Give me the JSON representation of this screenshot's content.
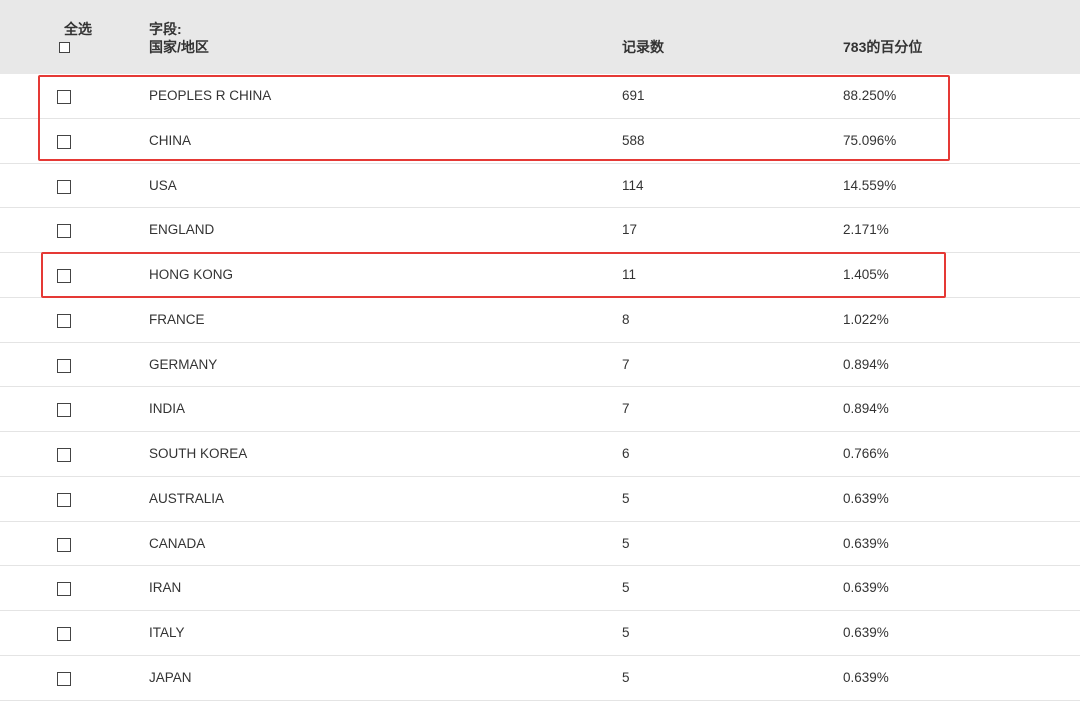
{
  "header": {
    "select_all": "全选",
    "field_label": "字段:",
    "field_name": "国家/地区",
    "count": "记录数",
    "percent": "783的百分位"
  },
  "rows": [
    {
      "name": "PEOPLES R CHINA",
      "count": "691",
      "percent": "88.250%"
    },
    {
      "name": "CHINA",
      "count": "588",
      "percent": "75.096%"
    },
    {
      "name": "USA",
      "count": "114",
      "percent": "14.559%"
    },
    {
      "name": "ENGLAND",
      "count": "17",
      "percent": "2.171%"
    },
    {
      "name": "HONG KONG",
      "count": "11",
      "percent": "1.405%"
    },
    {
      "name": "FRANCE",
      "count": "8",
      "percent": "1.022%"
    },
    {
      "name": "GERMANY",
      "count": "7",
      "percent": "0.894%"
    },
    {
      "name": "INDIA",
      "count": "7",
      "percent": "0.894%"
    },
    {
      "name": "SOUTH KOREA",
      "count": "6",
      "percent": "0.766%"
    },
    {
      "name": "AUSTRALIA",
      "count": "5",
      "percent": "0.639%"
    },
    {
      "name": "CANADA",
      "count": "5",
      "percent": "0.639%"
    },
    {
      "name": "IRAN",
      "count": "5",
      "percent": "0.639%"
    },
    {
      "name": "ITALY",
      "count": "5",
      "percent": "0.639%"
    },
    {
      "name": "JAPAN",
      "count": "5",
      "percent": "0.639%"
    }
  ],
  "colors": {
    "header_bg": "#e8e8e8",
    "highlight": "#e53935",
    "text": "#333333"
  }
}
